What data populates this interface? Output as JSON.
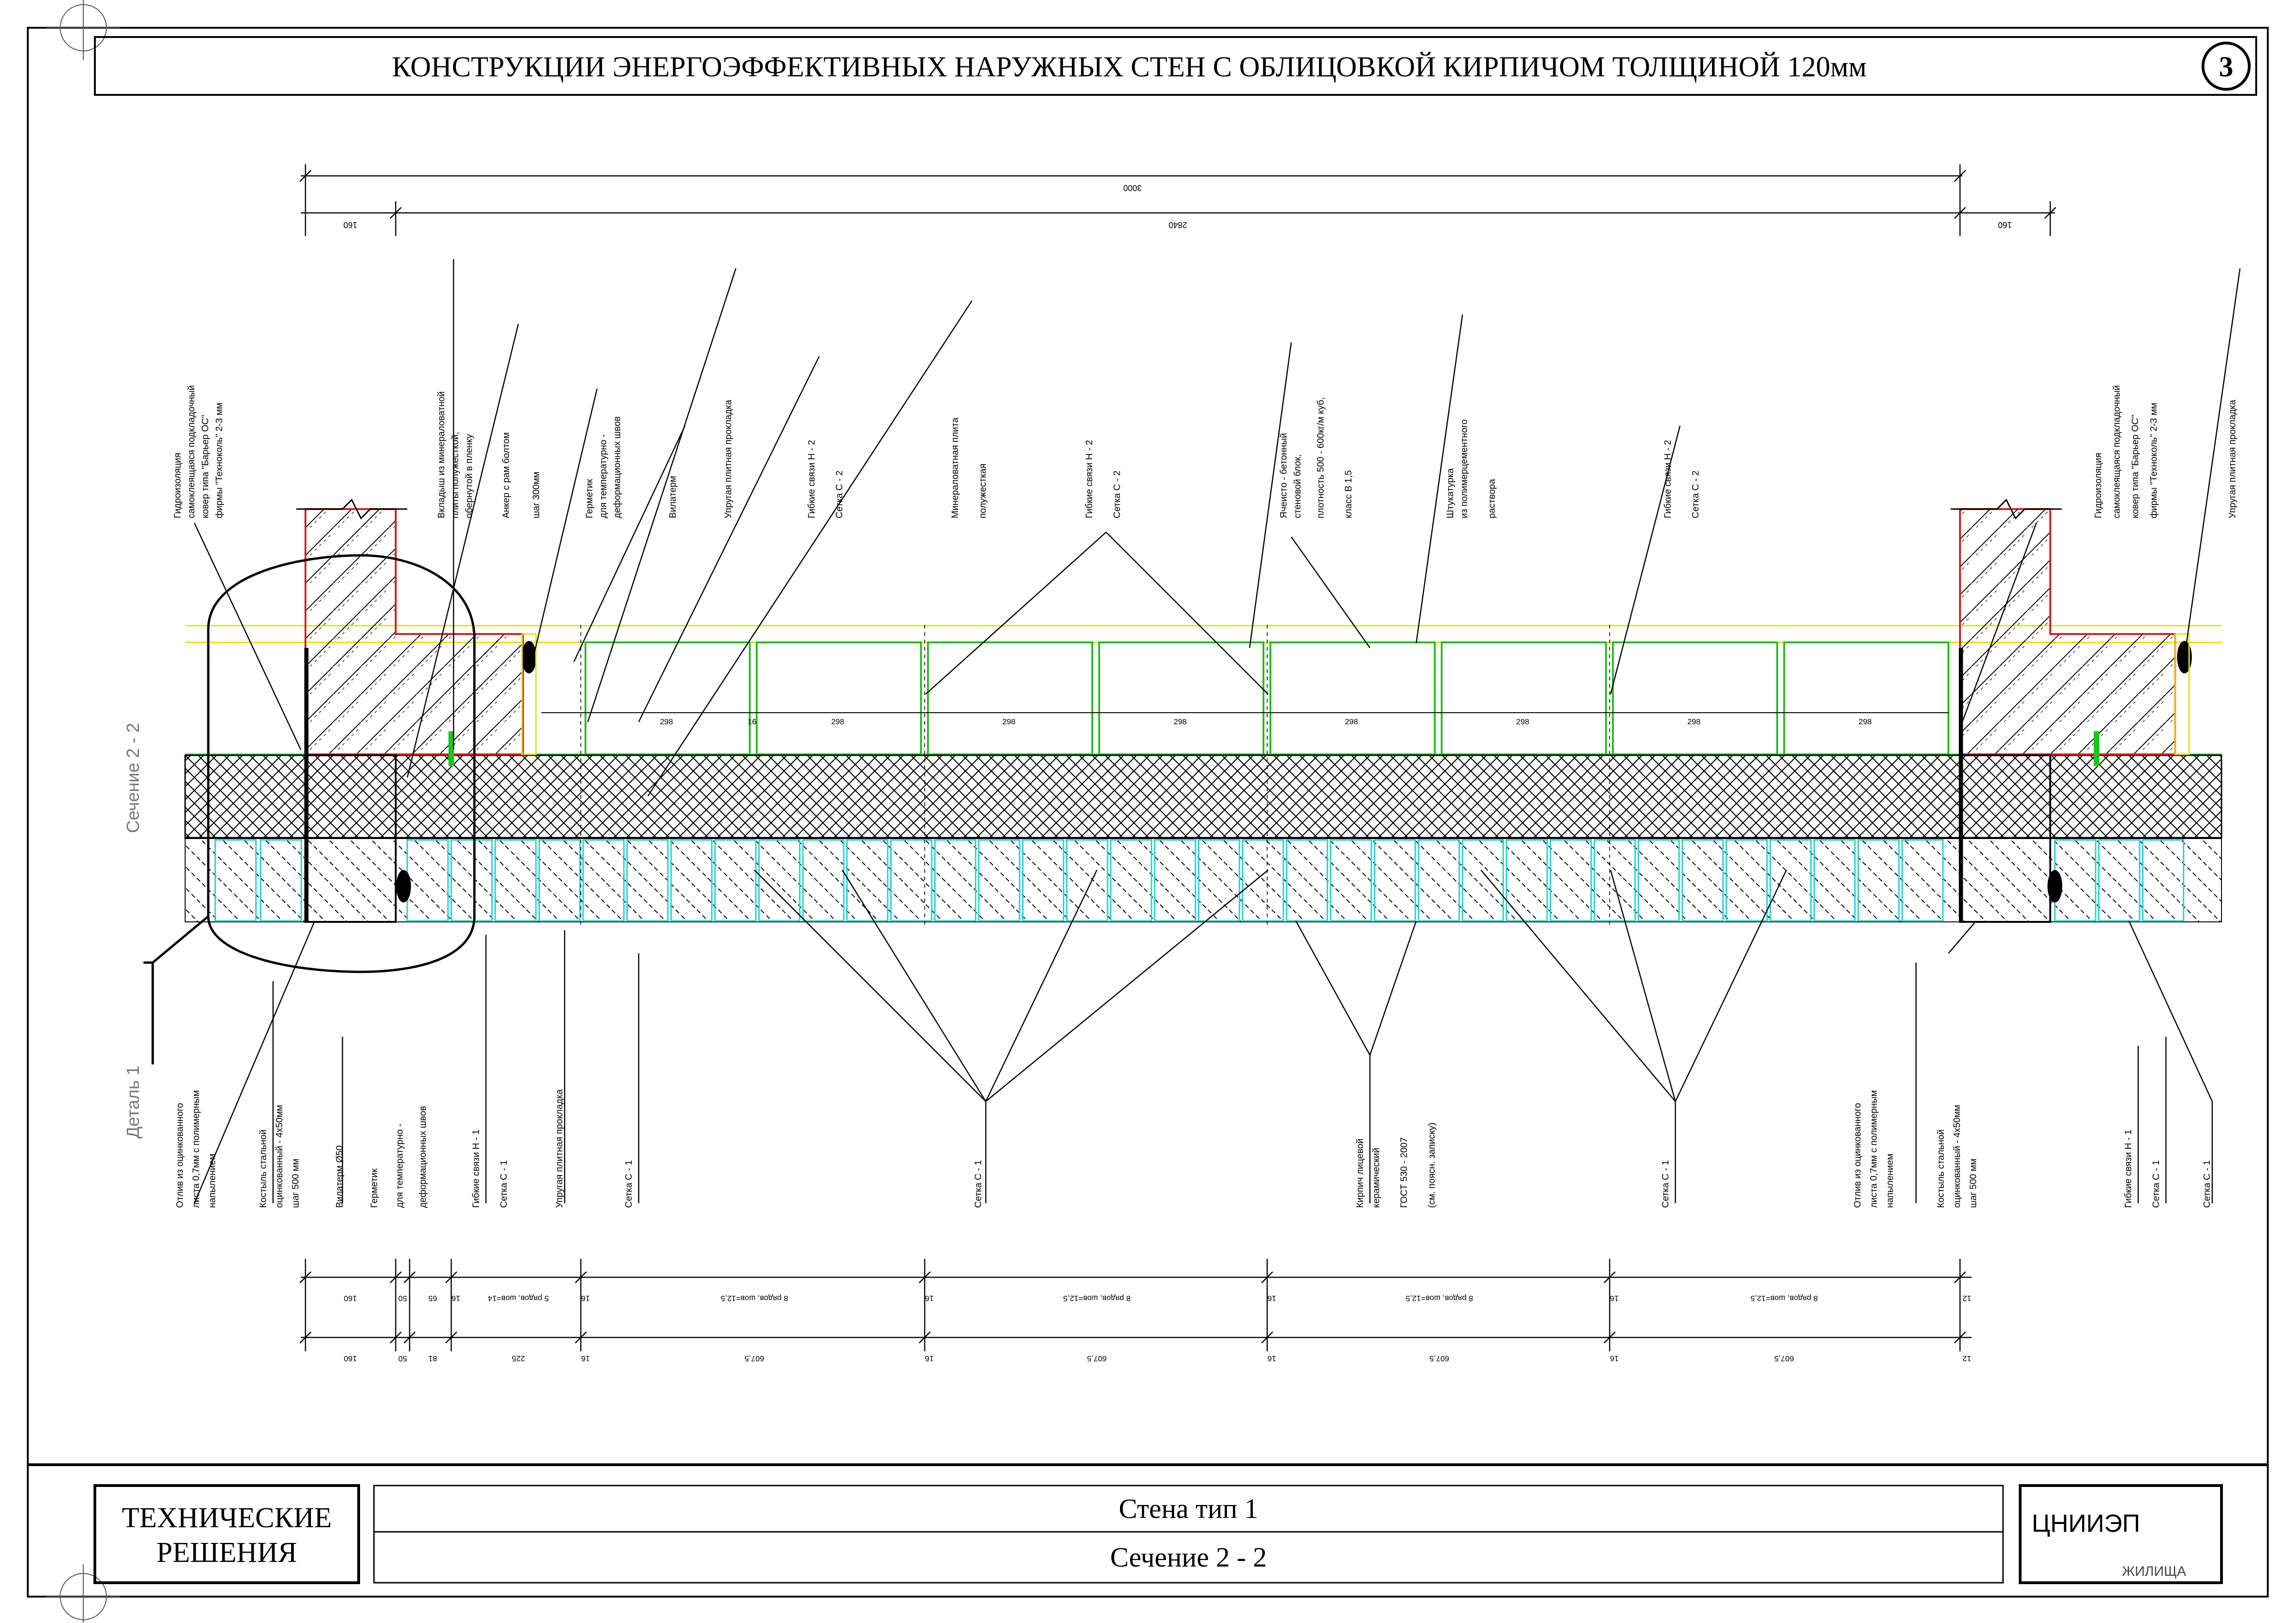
{
  "title": "КОНСТРУКЦИИ ЭНЕРГОЭФФЕКТИВНЫХ НАРУЖНЫХ СТЕН С ОБЛИЦОВКОЙ КИРПИЧОМ ТОЛЩИНОЙ 120мм",
  "sheet_number": "3",
  "section_label": "Сечение 2 - 2",
  "detail_label": "Деталь 1",
  "colors": {
    "ink": "#000000",
    "gypsum_yellow": "#e8e000",
    "block_green": "#1fbf1f",
    "brick_cyan": "#19d3d3",
    "concrete_red": "#e01818",
    "anchor_green": "#18c818"
  },
  "top_dims": {
    "overall": "3000",
    "left_end": "160",
    "middle": "2840",
    "right_end": "160"
  },
  "top_callouts": [
    "Гидроизоляция",
    "самоклеящаяся подкладочный",
    "ковер типа \"Барьер ОС\"",
    "фирмы \"Техноколь\" 2-3 мм",
    "Вкладыш из минераловатной",
    "плиты полужесткой,",
    "обернутой в пленку",
    "Анкер с рам болтом",
    "шаг 300мм",
    "Герметик",
    "для температурно -",
    "деформационных швов",
    "Вилатерм",
    "Упругая плитная прокладка",
    "Гибкие связи Н - 2",
    "Сетка С - 2",
    "Минераловатная плита",
    "полужесткая",
    "Гибкие связи Н - 2",
    "Сетка С - 2",
    "Ячеисто - бетонный",
    "стеновой блок,",
    "плотность 500 - 600кг/м куб,",
    "класс  В 1,5",
    "Штукатурка",
    "из полимерцементного",
    "раствора",
    "Гибкие связи Н - 2",
    "Сетка С - 2",
    "Гидроизоляция",
    "самоклеящаяся подкладочный",
    "ковер типа \"Барьер ОС\"",
    "фирмы \"Техноколь\" 2-3 мм",
    "Упругая плитная прокладка"
  ],
  "bottom_callouts": [
    "Отлив из оцинкованного",
    "листа 0,7мм с полимерным",
    "напылением",
    "Костыль стальной",
    "оцинкованный - 4х50мм",
    "шаг 500 мм",
    "Вилатерм Ø50",
    "Герметик",
    "для температурно -",
    "деформационных швов",
    "Гибкие связи Н - 1",
    "Сетка С - 1",
    "Упругая плитная прокладка",
    "Сетка С - 1",
    "Сетка С - 1",
    "Кирпич лицевой",
    "керамический",
    "ГОСТ 530 - 2007",
    "(см. поясн. записку)",
    "Сетка С - 1",
    "Отлив из оцинкованного",
    "листа 0,7мм с полимерным",
    "напылением",
    "Костыль стальной",
    "оцинкованный - 4х50мм",
    "шаг 500 мм",
    "Гибкие связи Н - 1",
    "Сетка С - 1",
    "Сетка С - 1"
  ],
  "block_dims": [
    "298",
    "298",
    "298",
    "298",
    "298",
    "298",
    "298",
    "298"
  ],
  "block_joint": "16",
  "bottom_dims_row1": [
    "160",
    "50",
    "65",
    "16",
    "5 рядов, шов=14",
    "16",
    "8 рядов, шов=12,5",
    "16",
    "8 рядов, шов=12,5",
    "16",
    "8 рядов, шов=12,5",
    "16",
    "8 рядов, шов=12,5",
    "12"
  ],
  "bottom_dims_row2": [
    "160",
    "50",
    "81",
    "225",
    "16",
    "607,5",
    "16",
    "607,5",
    "16",
    "607,5",
    "16",
    "607,5",
    "12"
  ],
  "footer": {
    "left": "ТЕХНИЧЕСКИЕ\nРЕШЕНИЯ",
    "left_line1": "ТЕХНИЧЕСКИЕ",
    "left_line2": "РЕШЕНИЯ",
    "center_top": "Стена тип 1",
    "center_bottom": "Сечение 2 - 2",
    "org": "ЦНИИЭП",
    "org_sub": "ЖИЛИЩА"
  }
}
